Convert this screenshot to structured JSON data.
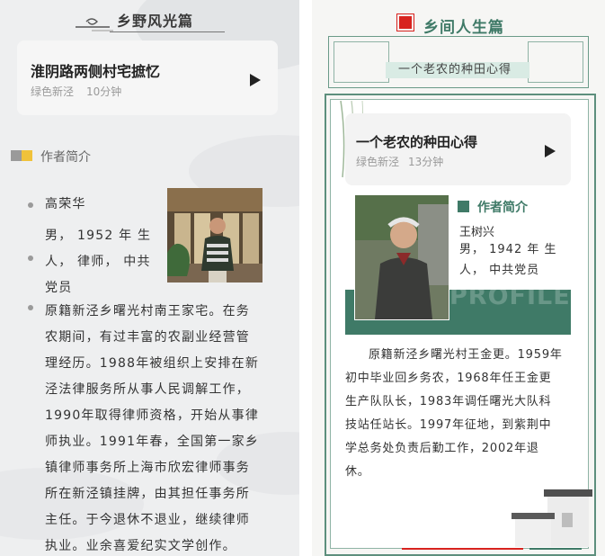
{
  "left": {
    "section_title": "乡野风光篇",
    "card": {
      "title": "淮阴路两侧村宅摭忆",
      "source": "绿色新泾",
      "duration": "10分钟"
    },
    "author_heading": "作者简介",
    "author_name": "高荣华",
    "author_profile_lines": [
      "男， 1952 年 生",
      "人， 律师， 中共",
      "党员"
    ],
    "bio_lines": [
      "原籍新泾乡曙光村南王家宅。在务",
      "农期间，有过丰富的农副业经营管",
      "理经历。1988年被组织上安排在新",
      "泾法律服务所从事人民调解工作，",
      "1990年取得律师资格，开始从事律",
      "师执业。1991年春，全国第一家乡",
      "镇律师事务所上海市欣宏律师事务",
      "所在新泾镇挂牌，由其担任事务所",
      "主任。于今退休不退业，继续律师",
      "执业。业余喜爱纪实文学创作。"
    ]
  },
  "right": {
    "section_title": "乡间人生篇",
    "subtitle": "一个老农的种田心得",
    "card": {
      "title": "一个老农的种田心得",
      "source": "绿色新泾",
      "duration": "13分钟"
    },
    "author_heading": "作者简介",
    "author_name": "王树兴",
    "author_profile_lines": [
      "男， 1942 年 生",
      "人， 中共党员"
    ],
    "watermark": "PROFILE",
    "bio_lines": [
      "原籍新泾乡曙光村王金更。1959年",
      "初中毕业回乡务农，1968年任王金更",
      "生产队队长，1983年调任曙光大队科",
      "技站任站长。1997年征地，到紫荆中",
      "学总务处负责后勤工作，2002年退",
      "休。"
    ]
  },
  "colors": {
    "accent_green": "#3f7a67",
    "accent_red": "#d8231f",
    "accent_yellow": "#f0c23a"
  }
}
